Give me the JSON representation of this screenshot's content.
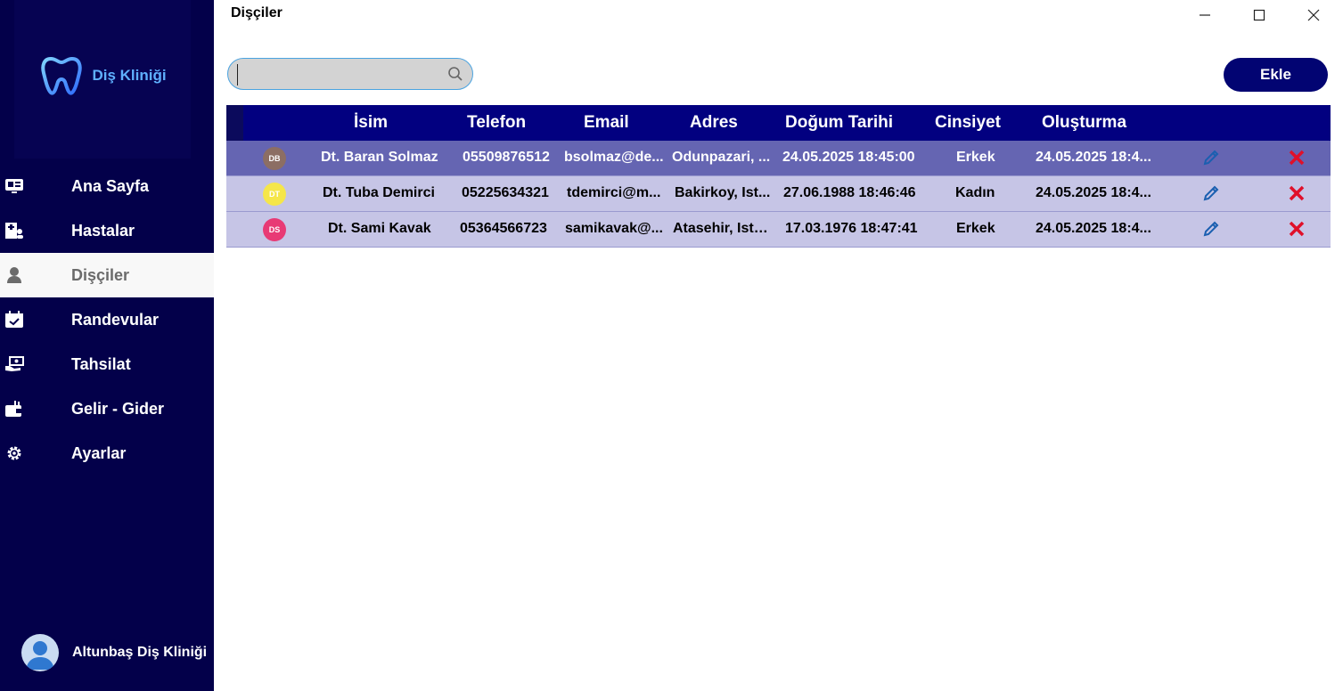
{
  "window": {
    "title": "Dişçiler"
  },
  "sidebar": {
    "logo_text": "Diş Kliniği",
    "items": [
      {
        "label": "Ana Sayfa",
        "icon": "dashboard-icon"
      },
      {
        "label": "Hastalar",
        "icon": "patients-icon"
      },
      {
        "label": "Dişçiler",
        "icon": "dentist-icon",
        "active": true
      },
      {
        "label": "Randevular",
        "icon": "calendar-icon"
      },
      {
        "label": "Tahsilat",
        "icon": "payment-icon"
      },
      {
        "label": "Gelir - Gider",
        "icon": "wallet-icon"
      },
      {
        "label": "Ayarlar",
        "icon": "gear-icon"
      }
    ],
    "user_name": "Altunbaş Diş Kliniği"
  },
  "toolbar": {
    "search_value": "",
    "add_label": "Ekle"
  },
  "table": {
    "columns": [
      "İsim",
      "Telefon",
      "Email",
      "Adres",
      "Doğum Tarihi",
      "Cinsiyet",
      "Oluşturma"
    ],
    "rows": [
      {
        "initials": "DB",
        "badge_color": "#8c6e64",
        "name": "Dt. Baran Solmaz",
        "phone": "05509876512",
        "email": "bsolmaz@de...",
        "address": "Odunpazari, ...",
        "birth": "24.05.2025 18:45:00",
        "gender": "Erkek",
        "created": "24.05.2025 18:4...",
        "selected": true
      },
      {
        "initials": "DT",
        "badge_color": "#f5e64a",
        "name": "Dt. Tuba Demirci",
        "phone": "05225634321",
        "email": "tdemirci@m...",
        "address": "Bakirkoy, Ist...",
        "birth": "27.06.1988 18:46:46",
        "gender": "Kadın",
        "created": "24.05.2025 18:4...",
        "selected": false
      },
      {
        "initials": "DS",
        "badge_color": "#e83a75",
        "name": "Dt. Sami Kavak",
        "phone": "05364566723",
        "email": "samikavak@...",
        "address": "Atasehir, Ista...",
        "birth": "17.03.1976 18:47:41",
        "gender": "Erkek",
        "created": "24.05.2025 18:4...",
        "selected": false
      }
    ]
  },
  "colors": {
    "sidebar_bg": "#03004a",
    "header_bg": "#020080",
    "selected_row": "#6565b2",
    "row_bg": "#c6c5e6",
    "accent_blue": "#5fb0ff",
    "delete_red": "#e0102a"
  }
}
